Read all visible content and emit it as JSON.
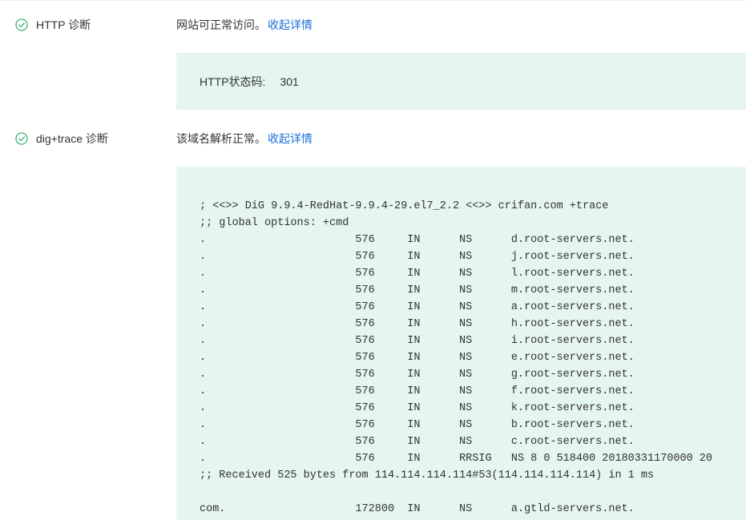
{
  "http_diag": {
    "icon": "check-circle-icon",
    "title": "HTTP 诊断",
    "status_text": "网站可正常访问。",
    "detail_link": "收起详情",
    "label": "HTTP状态码:",
    "value": "301"
  },
  "dig_diag": {
    "icon": "check-circle-icon",
    "title": "dig+trace 诊断",
    "status_text": "该域名解析正常。",
    "detail_link": "收起详情",
    "output_lines": [
      "; <<>> DiG 9.9.4-RedHat-9.9.4-29.el7_2.2 <<>> crifan.com +trace",
      ";; global options: +cmd",
      ".                       576     IN      NS      d.root-servers.net.",
      ".                       576     IN      NS      j.root-servers.net.",
      ".                       576     IN      NS      l.root-servers.net.",
      ".                       576     IN      NS      m.root-servers.net.",
      ".                       576     IN      NS      a.root-servers.net.",
      ".                       576     IN      NS      h.root-servers.net.",
      ".                       576     IN      NS      i.root-servers.net.",
      ".                       576     IN      NS      e.root-servers.net.",
      ".                       576     IN      NS      g.root-servers.net.",
      ".                       576     IN      NS      f.root-servers.net.",
      ".                       576     IN      NS      k.root-servers.net.",
      ".                       576     IN      NS      b.root-servers.net.",
      ".                       576     IN      NS      c.root-servers.net.",
      ".                       576     IN      RRSIG   NS 8 0 518400 20180331170000 20",
      ";; Received 525 bytes from 114.114.114.114#53(114.114.114.114) in 1 ms",
      "",
      "com.                    172800  IN      NS      a.gtld-servers.net."
    ]
  },
  "colors": {
    "accent_green": "#3cb371",
    "link_blue": "#1a6fd9",
    "panel_bg": "#e5f6ee"
  }
}
